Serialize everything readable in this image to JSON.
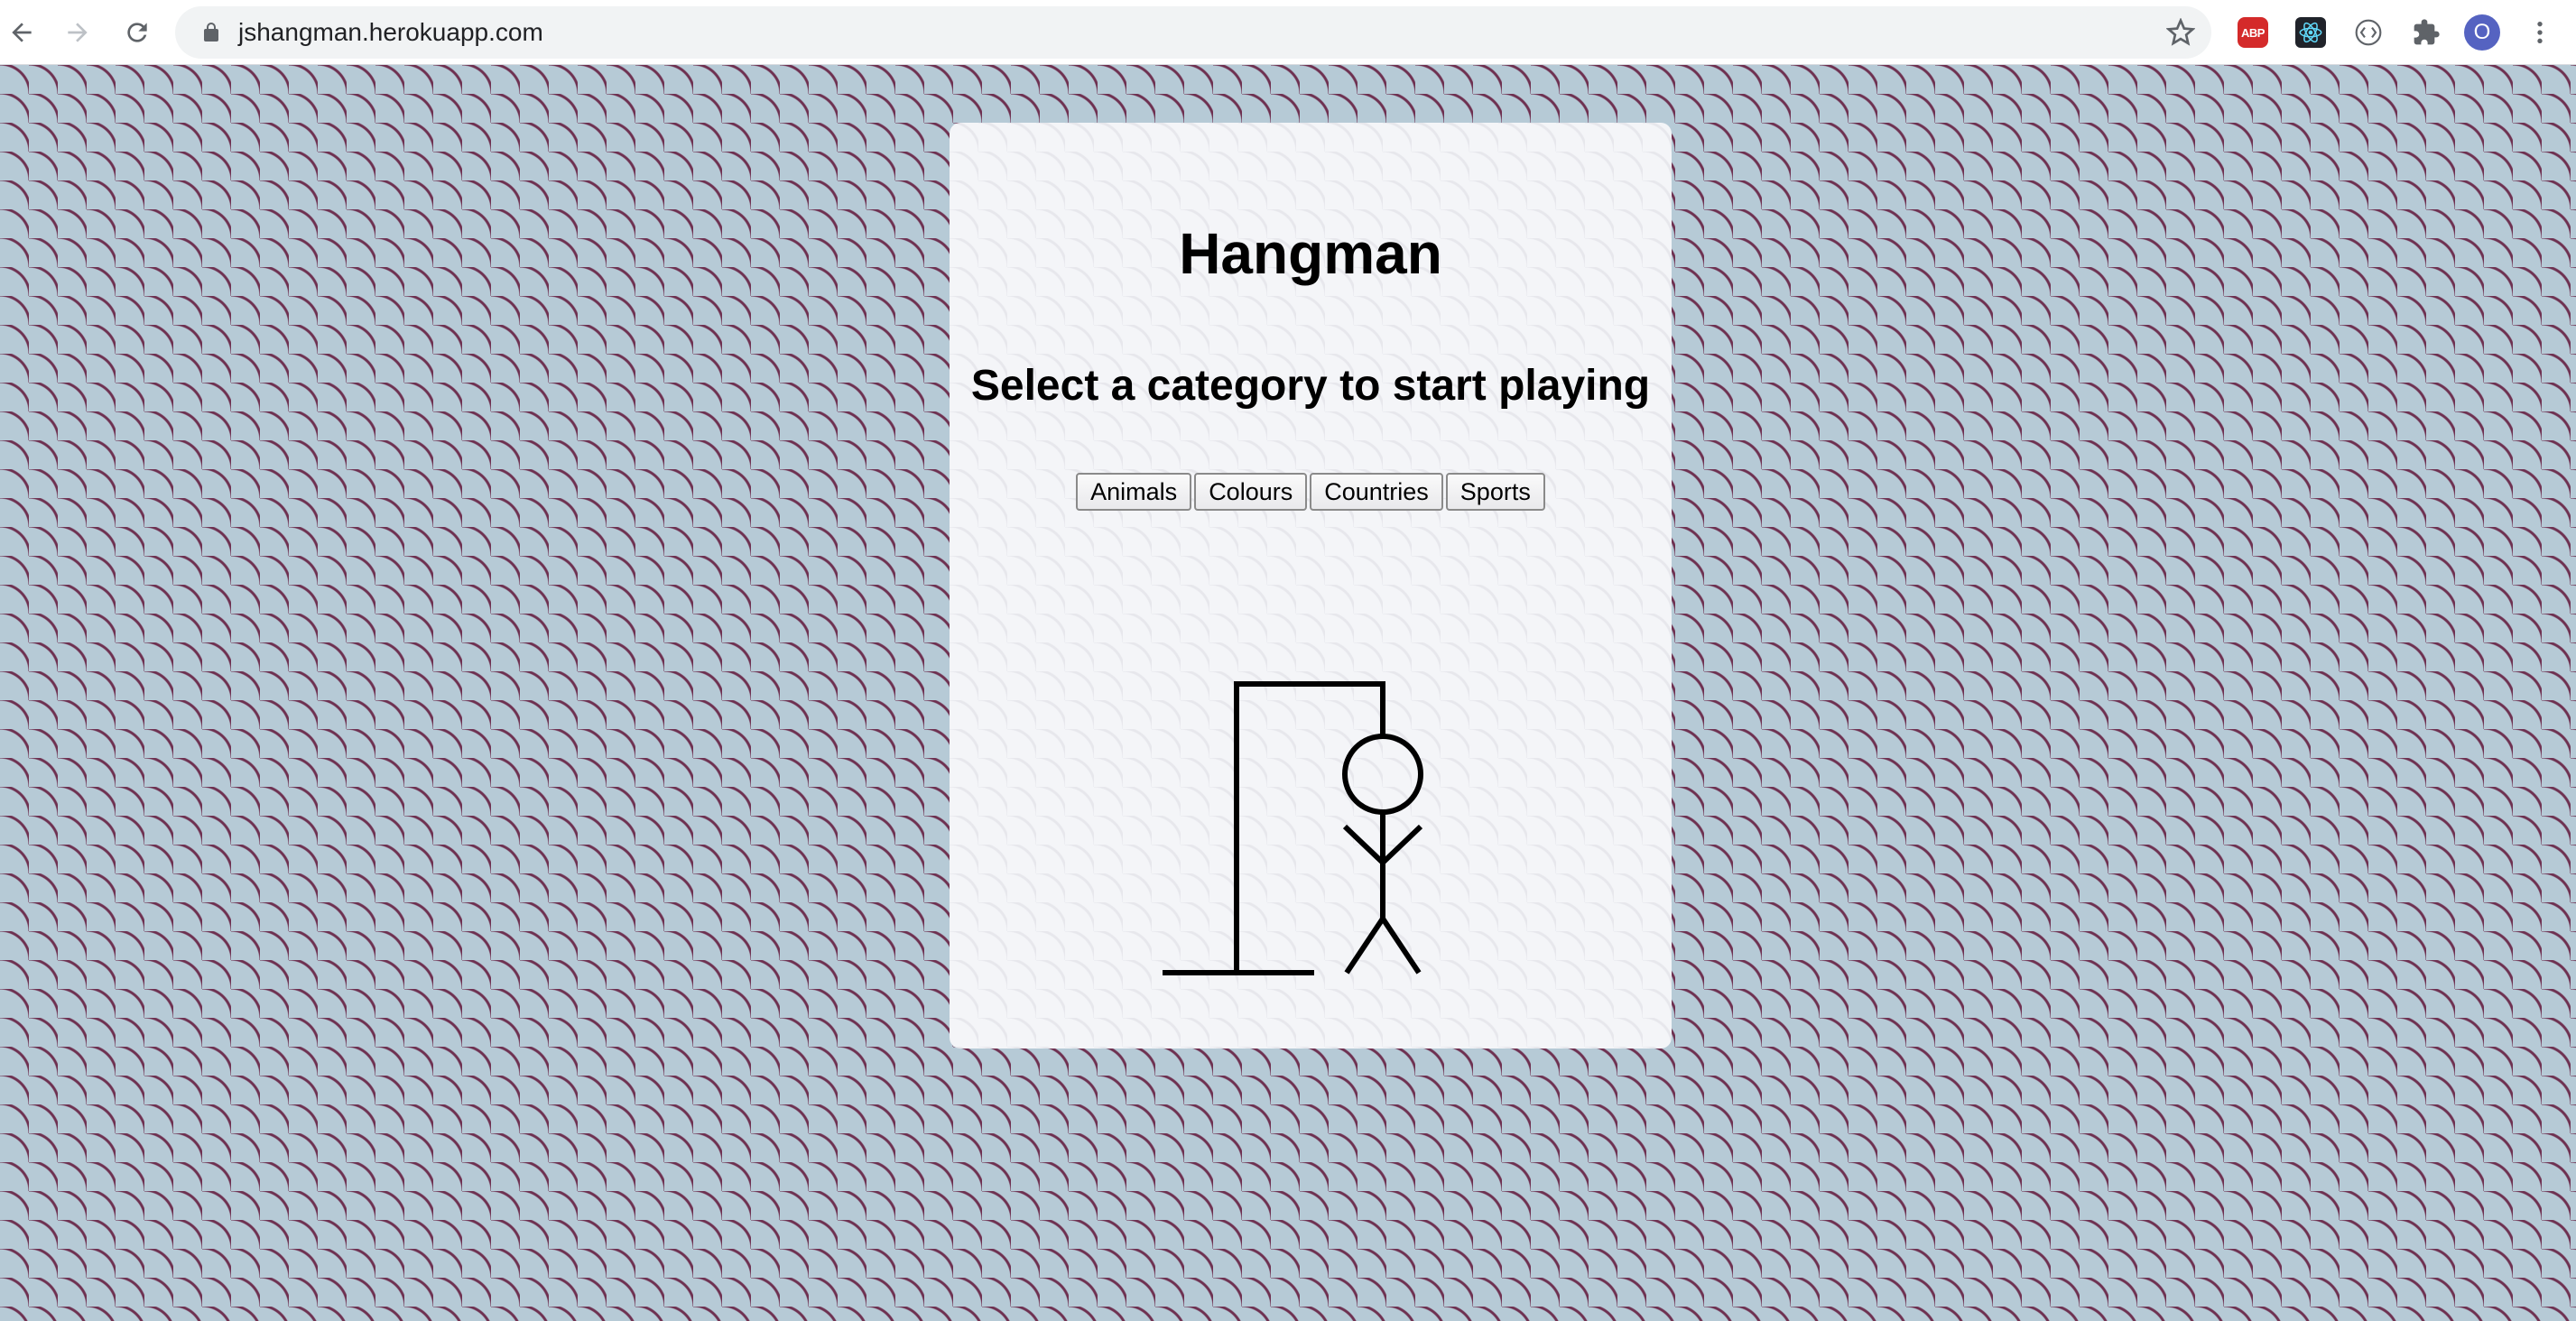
{
  "browser": {
    "url": "jshangman.herokuapp.com",
    "profile_initial": "O",
    "extensions": [
      "adblock-plus",
      "react-devtools",
      "code-extension",
      "extensions-puzzle"
    ]
  },
  "app": {
    "title": "Hangman",
    "subtitle": "Select a category to start playing",
    "categories": [
      "Animals",
      "Colours",
      "Countries",
      "Sports"
    ]
  },
  "colors": {
    "page_background": "#b6cad6",
    "pattern": "#6e3050",
    "card": "#f4f5f8"
  }
}
